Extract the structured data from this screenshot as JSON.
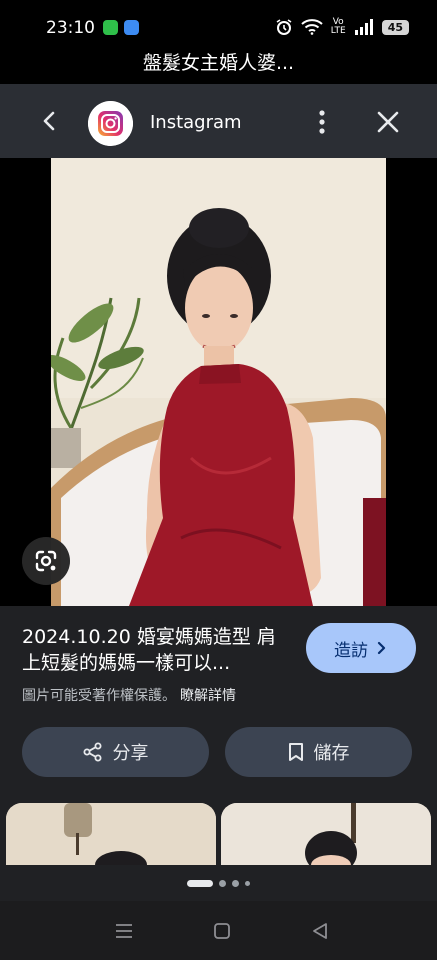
{
  "status_bar": {
    "time": "23:10",
    "battery": "45",
    "network_label_top": "Vo",
    "network_label_bottom": "LTE"
  },
  "top_title": "盤髮女主婚人婆...",
  "viewer": {
    "source_name": "Instagram",
    "back_icon": "chevron-left-icon",
    "menu_icon": "more-vert-icon",
    "close_icon": "close-icon"
  },
  "info": {
    "title": "2024.10.20 婚宴媽媽造型 肩上短髮的媽媽一樣可以...",
    "visit_label": "造訪",
    "copyright": "圖片可能受著作權保護。",
    "learn_more": "瞭解詳情",
    "share_label": "分享",
    "save_label": "儲存"
  },
  "colors": {
    "panel_bg": "#202124",
    "visit_button": "#a8c7fa",
    "action_button": "#3c4452",
    "dress": "#9e1828"
  }
}
